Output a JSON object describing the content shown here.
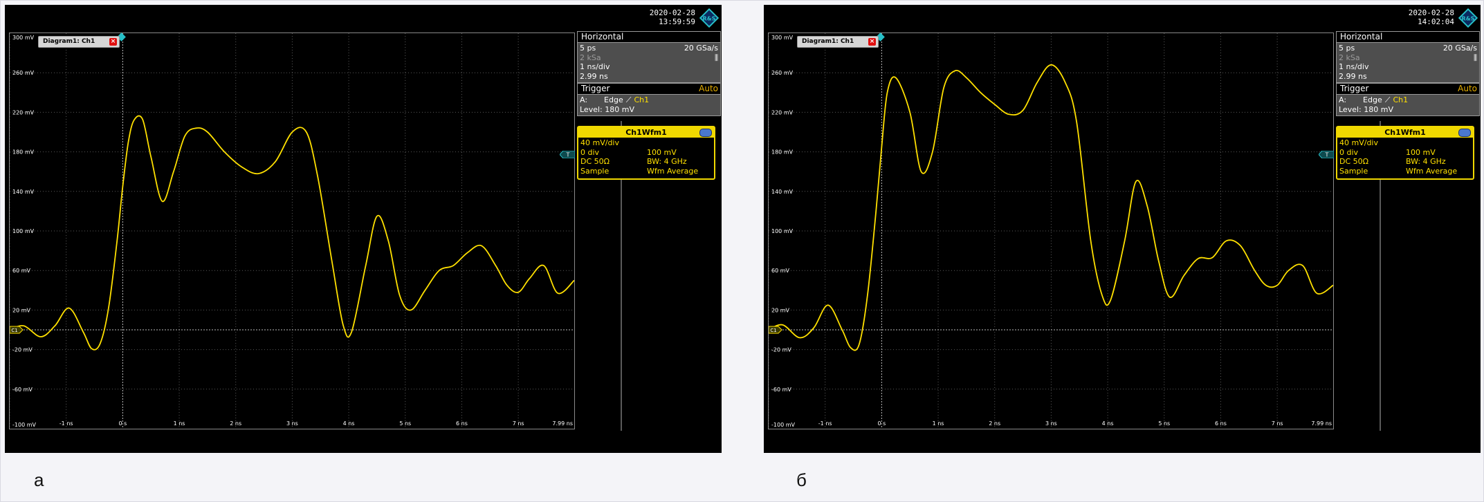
{
  "captions": {
    "left": "а",
    "right": "б"
  },
  "colors": {
    "trace": "#ffe000",
    "grid": "#5a5a5a",
    "axis": "#bdbdbd",
    "accent": "#27c0c8"
  },
  "screens": [
    {
      "id": "a",
      "date": "2020-02-28",
      "time": "13:59:59",
      "diagram_tab": "Diagram1: Ch1",
      "horizontal": {
        "title": "Horizontal",
        "resolution": "5 ps",
        "sample_rate": "20 GSa/s",
        "record_length": "2 kSa",
        "time_scale": "1 ns/div",
        "position": "2.99 ns"
      },
      "trigger": {
        "title": "Trigger",
        "mode": "Auto",
        "source_label": "A:",
        "type": "Edge",
        "channel": "Ch1",
        "level": "Level: 180 mV"
      },
      "waveform": {
        "title": "Ch1Wfm1",
        "scale": "40 mV/div",
        "position": "0 div",
        "offset": "100 mV",
        "coupling": "DC 50Ω",
        "bandwidth": "BW: 4 GHz",
        "acq_mode": "Sample",
        "arith": "Wfm Average"
      },
      "trigger_marker": "T",
      "channel_marker": "C1",
      "chart_data": {
        "type": "line",
        "xlim": [
          -2.0,
          7.99
        ],
        "ylim": [
          -100,
          300
        ],
        "y_ticks": [
          "300 mV",
          "260 mV",
          "220 mV",
          "180 mV",
          "140 mV",
          "100 mV",
          "60 mV",
          "20 mV",
          "-20 mV",
          "-60 mV",
          "-100 mV"
        ],
        "x_ticks": [
          "-1 ns",
          "0 s",
          "1 ns",
          "2 ns",
          "3 ns",
          "4 ns",
          "5 ns",
          "6 ns",
          "7 ns",
          "7.99 ns"
        ],
        "grid": true,
        "series": [
          {
            "x": [
              -2.0,
              -1.75,
              -1.45,
              -1.2,
              -0.95,
              -0.7,
              -0.55,
              -0.4,
              -0.25,
              -0.1,
              0.0,
              0.1,
              0.2,
              0.35,
              0.5,
              0.7,
              0.9,
              1.1,
              1.3,
              1.5,
              1.8,
              2.1,
              2.4,
              2.7,
              3.0,
              3.25,
              3.45,
              3.7,
              3.9,
              4.05,
              4.3,
              4.5,
              4.7,
              4.9,
              5.1,
              5.35,
              5.6,
              5.85,
              6.1,
              6.35,
              6.6,
              6.8,
              7.0,
              7.2,
              7.45,
              7.7,
              7.99
            ],
            "y": [
              0,
              4,
              -7,
              4,
              22,
              -2,
              -19,
              -14,
              22,
              90,
              145,
              190,
              212,
              213,
              175,
              130,
              160,
              196,
              204,
              200,
              180,
              165,
              158,
              170,
              200,
              200,
              155,
              70,
              5,
              -2,
              65,
              115,
              90,
              35,
              20,
              40,
              60,
              65,
              78,
              85,
              65,
              45,
              38,
              52,
              65,
              37,
              50
            ]
          }
        ]
      }
    },
    {
      "id": "b",
      "date": "2020-02-28",
      "time": "14:02:04",
      "diagram_tab": "Diagram1: Ch1",
      "horizontal": {
        "title": "Horizontal",
        "resolution": "5 ps",
        "sample_rate": "20 GSa/s",
        "record_length": "2 kSa",
        "time_scale": "1 ns/div",
        "position": "2.99 ns"
      },
      "trigger": {
        "title": "Trigger",
        "mode": "Auto",
        "source_label": "A:",
        "type": "Edge",
        "channel": "Ch1",
        "level": "Level: 180 mV"
      },
      "waveform": {
        "title": "Ch1Wfm1",
        "scale": "40 mV/div",
        "position": "0 div",
        "offset": "100 mV",
        "coupling": "DC 50Ω",
        "bandwidth": "BW: 4 GHz",
        "acq_mode": "Sample",
        "arith": "Wfm Average"
      },
      "trigger_marker": "T",
      "channel_marker": "C1",
      "chart_data": {
        "type": "line",
        "xlim": [
          -2.0,
          7.99
        ],
        "ylim": [
          -100,
          300
        ],
        "y_ticks": [
          "300 mV",
          "260 mV",
          "220 mV",
          "180 mV",
          "140 mV",
          "100 mV",
          "60 mV",
          "20 mV",
          "-20 mV",
          "-60 mV",
          "-100 mV"
        ],
        "x_ticks": [
          "-1 ns",
          "0 s",
          "1 ns",
          "2 ns",
          "3 ns",
          "4 ns",
          "5 ns",
          "6 ns",
          "7 ns",
          "7.99 ns"
        ],
        "grid": true,
        "series": [
          {
            "x": [
              -2.0,
              -1.75,
              -1.45,
              -1.2,
              -0.95,
              -0.7,
              -0.55,
              -0.4,
              -0.25,
              -0.1,
              0.0,
              0.1,
              0.25,
              0.5,
              0.7,
              0.9,
              1.1,
              1.3,
              1.5,
              1.75,
              2.0,
              2.25,
              2.5,
              2.75,
              3.0,
              3.25,
              3.45,
              3.7,
              3.9,
              4.05,
              4.3,
              4.5,
              4.7,
              4.9,
              5.1,
              5.35,
              5.6,
              5.85,
              6.1,
              6.35,
              6.6,
              6.8,
              7.0,
              7.2,
              7.45,
              7.7,
              7.99
            ],
            "y": [
              0,
              5,
              -8,
              2,
              25,
              0,
              -18,
              -15,
              35,
              120,
              185,
              240,
              255,
              220,
              160,
              180,
              245,
              262,
              255,
              240,
              228,
              218,
              222,
              250,
              268,
              250,
              210,
              90,
              35,
              30,
              90,
              150,
              125,
              70,
              33,
              55,
              72,
              73,
              90,
              85,
              60,
              45,
              45,
              60,
              65,
              37,
              45
            ]
          }
        ]
      }
    }
  ]
}
